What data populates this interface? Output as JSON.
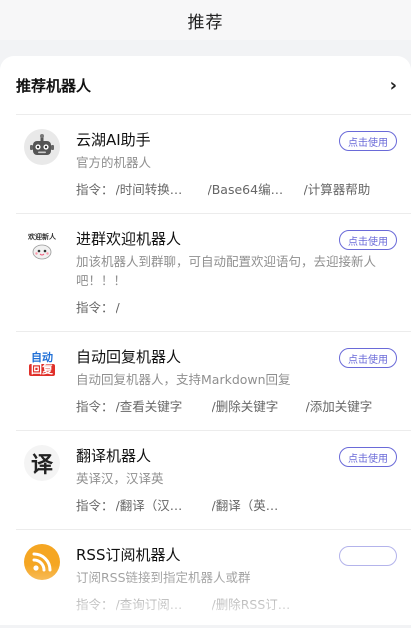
{
  "header": {
    "title": "推荐"
  },
  "section": {
    "title": "推荐机器人"
  },
  "bots": [
    {
      "name": "云湖AI助手",
      "desc": "官方的机器人",
      "cmd_label": "指令：",
      "cmds": [
        "/时间转换…",
        "/Base64编…",
        "/计算器帮助"
      ],
      "button": "点击使用",
      "icon": "robot-icon"
    },
    {
      "name": "进群欢迎机器人",
      "desc": "加该机器人到群聊，可自动配置欢迎语句，去迎接新人吧！！！",
      "cmd_label": "指令：",
      "cmds": [
        "/"
      ],
      "button": "点击使用",
      "icon_text": "欢迎新人"
    },
    {
      "name": "自动回复机器人",
      "desc": "自动回复机器人，支持Markdown回复",
      "cmd_label": "指令：",
      "cmds": [
        "/查看关键字",
        "/删除关键字",
        "/添加关键字"
      ],
      "button": "点击使用",
      "icon_text": [
        "自动",
        "回复"
      ]
    },
    {
      "name": "翻译机器人",
      "desc": "英译汉，汉译英",
      "cmd_label": "指令：",
      "cmds": [
        "/翻译（汉…",
        "/翻译（英…"
      ],
      "button": "点击使用",
      "icon_text": "译"
    },
    {
      "name": "RSS订阅机器人",
      "desc": "订阅RSS链接到指定机器人或群",
      "cmd_label": "指令：",
      "cmds": [
        "/查询订阅…",
        "/删除RSS订…"
      ],
      "button": "",
      "icon": "rss-icon"
    }
  ],
  "colors": {
    "accent": "#6a6ad8",
    "rss": "#f5a623",
    "auto_blue": "#1f6fd6",
    "auto_red": "#e0302a"
  }
}
